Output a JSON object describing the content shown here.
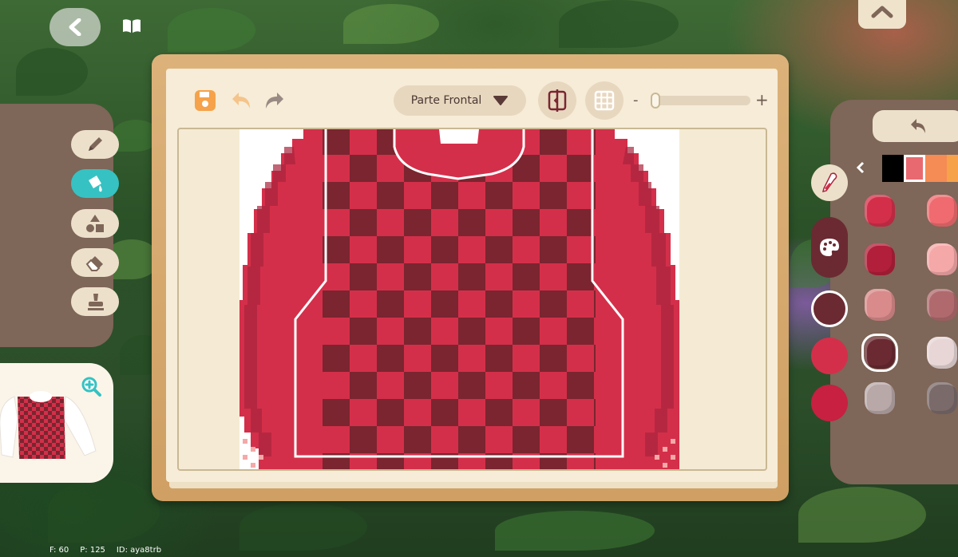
{
  "toolbar": {
    "section_label": "Parte Frontal",
    "zoom_minus": "-",
    "zoom_plus": "+",
    "zoom_level": 0.0
  },
  "tools": [
    {
      "name": "pencil-icon",
      "active": false
    },
    {
      "name": "paint-bucket-icon",
      "active": true
    },
    {
      "name": "shapes-icon",
      "active": false
    },
    {
      "name": "eraser-icon",
      "active": false
    },
    {
      "name": "stamp-icon",
      "active": false
    }
  ],
  "palette": {
    "strip": [
      "#000000",
      "#e86a70",
      "#f58b55",
      "#f5a24a"
    ],
    "strip_selected": 1,
    "current_color": "#d42f4a",
    "side_circles": [
      "#6b2a32",
      "#d42f4a",
      "#c72040"
    ],
    "swatches": [
      [
        "#d42f4a",
        "#ef6b6f"
      ],
      [
        "#b21f3a",
        "#f5a8a8"
      ],
      [
        "#d98a8a",
        "#b06a6e"
      ],
      [
        "#6b2a32",
        "#e8d6d6"
      ],
      [
        "#b8a8a8",
        "#7a6a6a"
      ]
    ],
    "selected_swatch": [
      3,
      0
    ]
  },
  "design": {
    "checker_dark": "#7a2530",
    "checker_red": "#d42f4a",
    "sleeve_color": "#d42f4a",
    "sleeve_shadow": "#a8243c"
  },
  "debug": {
    "fps": "F: 60",
    "ping": "P: 125",
    "id": "ID: aya8trb"
  }
}
